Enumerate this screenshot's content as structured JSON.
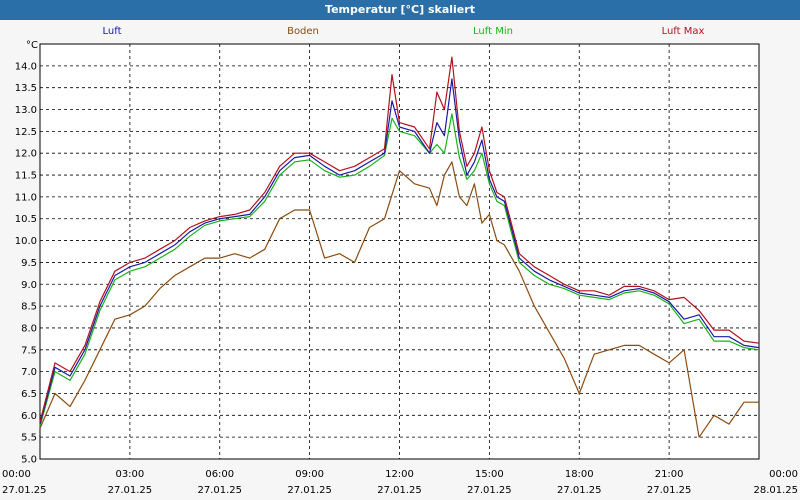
{
  "window": {
    "title": "Temperatur [°C] skaliert"
  },
  "chart_data": {
    "type": "line",
    "title": "Temperatur [°C] skaliert",
    "ylabel": "°C",
    "xlabel": "",
    "ylim": [
      5.0,
      14.5
    ],
    "y_ticks": [
      "5.0",
      "5.5",
      "6.0",
      "6.5",
      "7.0",
      "7.5",
      "8.0",
      "8.5",
      "9.0",
      "9.5",
      "10.0",
      "10.5",
      "11.0",
      "11.5",
      "12.0",
      "12.5",
      "13.0",
      "13.5",
      "14.0"
    ],
    "x_range_hours": [
      0,
      24
    ],
    "x_ticks": [
      {
        "time": "00:00",
        "date": "27.01.25"
      },
      {
        "time": "03:00",
        "date": "27.01.25"
      },
      {
        "time": "06:00",
        "date": "27.01.25"
      },
      {
        "time": "09:00",
        "date": "27.01.25"
      },
      {
        "time": "12:00",
        "date": "27.01.25"
      },
      {
        "time": "15:00",
        "date": "27.01.25"
      },
      {
        "time": "18:00",
        "date": "27.01.25"
      },
      {
        "time": "21:00",
        "date": "27.01.25"
      },
      {
        "time": "00:00",
        "date": "28.01.25"
      }
    ],
    "grid": true,
    "legend_position": "top",
    "series": [
      {
        "name": "Luft",
        "color": "#1a1aa6",
        "x": [
          0,
          0.5,
          1,
          1.5,
          2,
          2.5,
          3,
          3.5,
          4,
          4.5,
          5,
          5.5,
          6,
          6.5,
          7,
          7.5,
          8,
          8.5,
          9,
          9.5,
          10,
          10.5,
          11,
          11.5,
          11.75,
          12,
          12.5,
          13,
          13.25,
          13.5,
          13.75,
          14,
          14.25,
          14.5,
          14.75,
          15,
          15.25,
          15.5,
          16,
          16.5,
          17,
          17.5,
          18,
          18.5,
          19,
          19.5,
          20,
          20.5,
          21,
          21.5,
          22,
          22.5,
          23,
          23.5,
          24
        ],
        "values": [
          5.8,
          7.1,
          6.9,
          7.5,
          8.5,
          9.2,
          9.4,
          9.5,
          9.7,
          9.9,
          10.2,
          10.4,
          10.5,
          10.55,
          10.6,
          11.0,
          11.6,
          11.9,
          11.95,
          11.7,
          11.5,
          11.6,
          11.8,
          12.0,
          13.2,
          12.6,
          12.5,
          12.0,
          12.7,
          12.4,
          13.7,
          12.3,
          11.5,
          11.8,
          12.3,
          11.4,
          11.0,
          10.9,
          9.6,
          9.3,
          9.1,
          8.95,
          8.8,
          8.75,
          8.7,
          8.85,
          8.9,
          8.8,
          8.6,
          8.2,
          8.3,
          7.8,
          7.8,
          7.6,
          7.55
        ]
      },
      {
        "name": "Boden",
        "color": "#8b4c12",
        "x": [
          0,
          0.5,
          1,
          1.5,
          2,
          2.5,
          3,
          3.5,
          4,
          4.5,
          5,
          5.5,
          6,
          6.5,
          7,
          7.5,
          8,
          8.5,
          9,
          9.5,
          10,
          10.5,
          11,
          11.5,
          12,
          12.5,
          13,
          13.25,
          13.5,
          13.75,
          14,
          14.25,
          14.5,
          14.75,
          15,
          15.25,
          15.5,
          16,
          16.5,
          17,
          17.5,
          18,
          18.5,
          19,
          19.5,
          20,
          20.5,
          21,
          21.5,
          22,
          22.5,
          23,
          23.5,
          24
        ],
        "values": [
          5.7,
          6.5,
          6.2,
          6.8,
          7.5,
          8.2,
          8.3,
          8.5,
          8.9,
          9.2,
          9.4,
          9.6,
          9.6,
          9.7,
          9.6,
          9.8,
          10.5,
          10.7,
          10.7,
          9.6,
          9.7,
          9.5,
          10.3,
          10.5,
          11.6,
          11.3,
          11.2,
          10.8,
          11.5,
          11.8,
          11.0,
          10.8,
          11.3,
          10.4,
          10.6,
          10.0,
          9.9,
          9.3,
          8.5,
          7.9,
          7.3,
          6.5,
          7.4,
          7.5,
          7.6,
          7.6,
          7.4,
          7.2,
          7.5,
          5.5,
          6.0,
          5.8,
          6.3,
          6.3
        ]
      },
      {
        "name": "Luft Min",
        "color": "#19b319",
        "x": [
          0,
          0.5,
          1,
          1.5,
          2,
          2.5,
          3,
          3.5,
          4,
          4.5,
          5,
          5.5,
          6,
          6.5,
          7,
          7.5,
          8,
          8.5,
          9,
          9.5,
          10,
          10.5,
          11,
          11.5,
          11.75,
          12,
          12.5,
          13,
          13.25,
          13.5,
          13.75,
          14,
          14.25,
          14.5,
          14.75,
          15,
          15.25,
          15.5,
          16,
          16.5,
          17,
          17.5,
          18,
          18.5,
          19,
          19.5,
          20,
          20.5,
          21,
          21.5,
          22,
          22.5,
          23,
          23.5,
          24
        ],
        "values": [
          5.75,
          7.0,
          6.8,
          7.4,
          8.4,
          9.1,
          9.3,
          9.4,
          9.6,
          9.8,
          10.1,
          10.35,
          10.45,
          10.5,
          10.55,
          10.9,
          11.5,
          11.8,
          11.85,
          11.6,
          11.45,
          11.5,
          11.7,
          11.95,
          12.8,
          12.5,
          12.4,
          12.0,
          12.2,
          12.0,
          12.9,
          11.9,
          11.4,
          11.6,
          12.0,
          11.3,
          10.9,
          10.8,
          9.5,
          9.2,
          9.0,
          8.9,
          8.75,
          8.7,
          8.65,
          8.8,
          8.85,
          8.75,
          8.55,
          8.1,
          8.2,
          7.7,
          7.7,
          7.55,
          7.5
        ]
      },
      {
        "name": "Luft Max",
        "color": "#b3121e",
        "x": [
          0,
          0.5,
          1,
          1.5,
          2,
          2.5,
          3,
          3.5,
          4,
          4.5,
          5,
          5.5,
          6,
          6.5,
          7,
          7.5,
          8,
          8.5,
          9,
          9.5,
          10,
          10.5,
          11,
          11.5,
          11.75,
          12,
          12.5,
          13,
          13.25,
          13.5,
          13.75,
          14,
          14.25,
          14.5,
          14.75,
          15,
          15.25,
          15.5,
          16,
          16.5,
          17,
          17.5,
          18,
          18.5,
          19,
          19.5,
          20,
          20.5,
          21,
          21.5,
          22,
          22.5,
          23,
          23.5,
          24
        ],
        "values": [
          5.85,
          7.2,
          7.0,
          7.6,
          8.6,
          9.3,
          9.5,
          9.6,
          9.8,
          10.0,
          10.3,
          10.45,
          10.55,
          10.6,
          10.7,
          11.1,
          11.7,
          12.0,
          12.0,
          11.8,
          11.6,
          11.7,
          11.9,
          12.1,
          13.8,
          12.7,
          12.6,
          12.1,
          13.4,
          13.0,
          14.2,
          12.5,
          11.7,
          12.0,
          12.6,
          11.6,
          11.1,
          11.0,
          9.7,
          9.4,
          9.2,
          9.0,
          8.85,
          8.85,
          8.75,
          8.95,
          8.95,
          8.85,
          8.65,
          8.7,
          8.4,
          7.95,
          7.95,
          7.7,
          7.65
        ]
      }
    ]
  }
}
